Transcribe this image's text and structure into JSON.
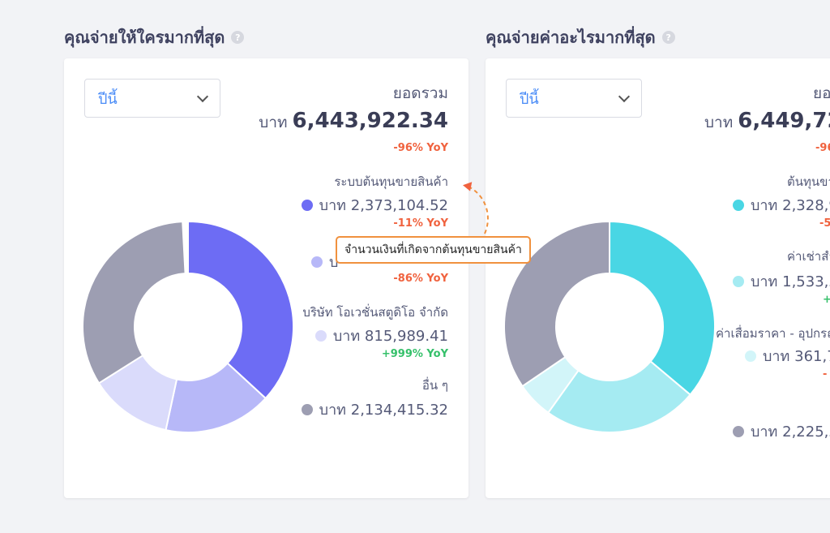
{
  "colors": {
    "left": [
      "#6d6cf4",
      "#b7b8f8",
      "#dadbfb",
      "#9d9eb2"
    ],
    "right": [
      "#49d6e4",
      "#a5ebf2",
      "#d2f5f9",
      "#9d9eb2"
    ],
    "accent_select": "#4a8cf7",
    "negative": "#f0623e",
    "positive": "#35c06a",
    "annotation": "#f0913e"
  },
  "left": {
    "title": "คุณจ่ายให้ใครมากที่สุด",
    "help_icon": "question-circle-icon",
    "period_select": "ปีนี้",
    "total_label": "ยอดรวม",
    "currency": "บาท",
    "total_value": "6,443,922.34",
    "total_yoy": "-96% YoY",
    "items": [
      {
        "name": "ระบบต้นทุนขายสินค้า",
        "value": "บาท 2,373,104.52",
        "yoy": "-11% YoY",
        "trend": "neg",
        "share": 0.3683
      },
      {
        "name": "",
        "value": "บ",
        "yoy": "-86% YoY",
        "trend": "neg",
        "share": 0.1656
      },
      {
        "name": "บริษัท โอเวชั่นสตูดิโอ จำกัด",
        "value": "บาท 815,989.41",
        "yoy": "+999% YoY",
        "trend": "pos",
        "share": 0.1266
      },
      {
        "name": "อื่น ๆ",
        "value": "บาท 2,134,415.32",
        "yoy": "",
        "trend": "",
        "share": 0.3312
      }
    ]
  },
  "right": {
    "title": "คุณจ่ายค่าอะไรมากที่สุด",
    "help_icon": "question-circle-icon",
    "period_select": "ปีนี้",
    "total_label": "ยอ",
    "currency": "บาท",
    "total_value": "6,449,72",
    "total_yoy": "-96",
    "items": [
      {
        "name": "ต้นทุนขา",
        "value": "บาท 2,328,9",
        "yoy": "-5",
        "trend": "neg",
        "share": 0.3611
      },
      {
        "name": "ค่าเช่าสำ",
        "value": "บาท 1,533,5",
        "yoy": "+",
        "trend": "pos",
        "share": 0.2378
      },
      {
        "name": "ค่าเสื่อมราคา - อุปกรณ",
        "value": "บาท 361,7",
        "yoy": "-",
        "trend": "neg",
        "share": 0.0561
      },
      {
        "name": "",
        "value": "บาท 2,225,5",
        "yoy": "",
        "trend": "",
        "share": 0.3451
      }
    ]
  },
  "tooltip": "จำนวนเงินที่เกิดจากต้นทุนขายสินค้า"
}
